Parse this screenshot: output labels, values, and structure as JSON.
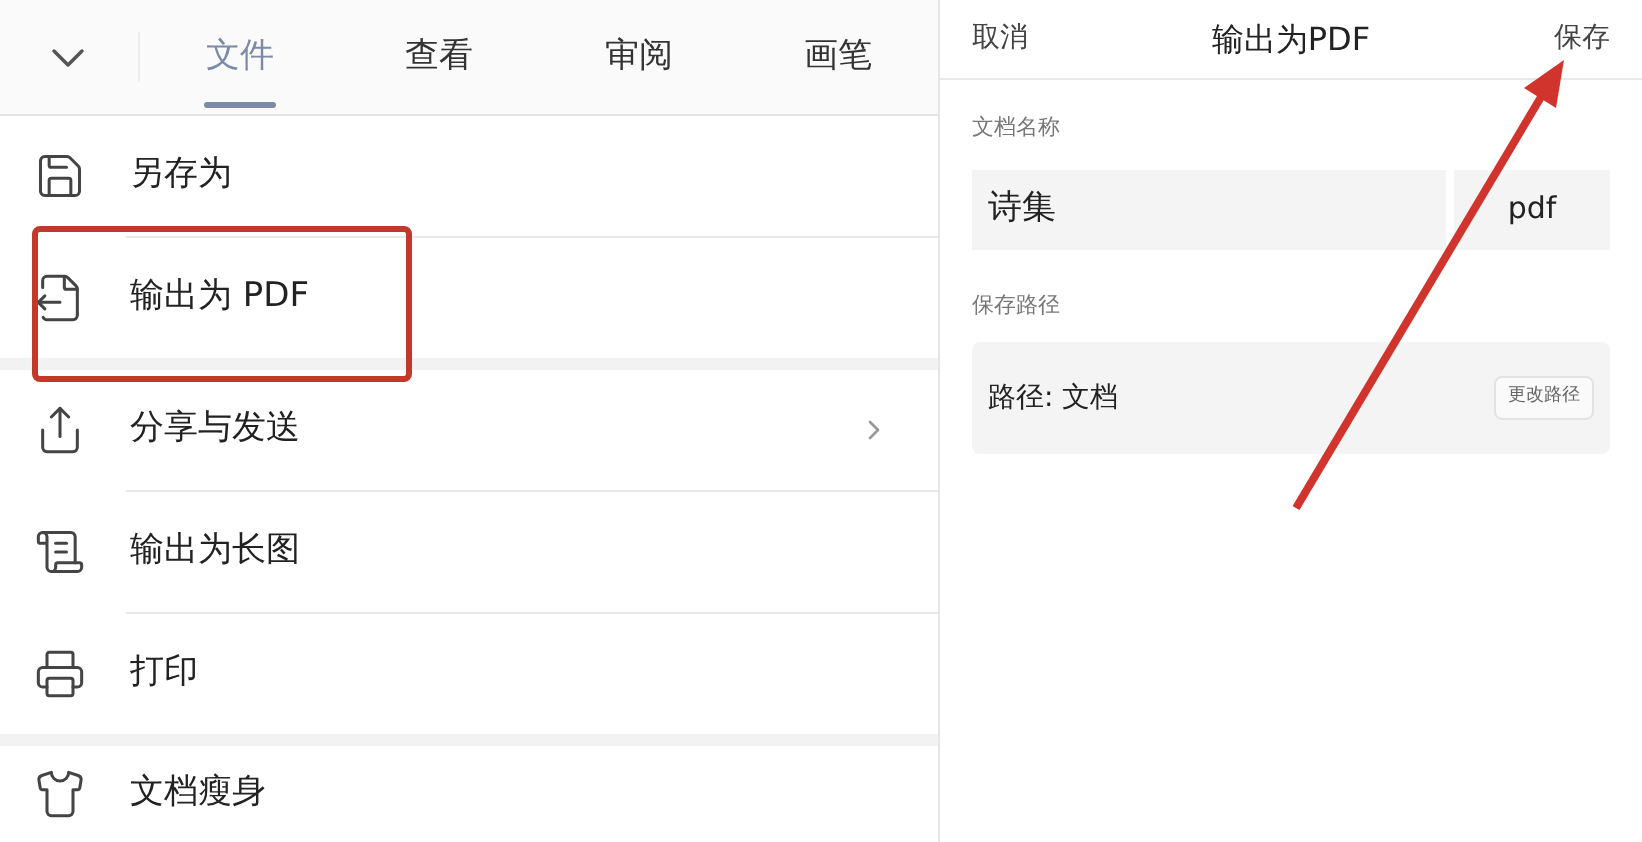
{
  "tabs": [
    {
      "label": "文件",
      "selected": true
    },
    {
      "label": "查看",
      "selected": false
    },
    {
      "label": "审阅",
      "selected": false
    },
    {
      "label": "画笔",
      "selected": false
    }
  ],
  "menu_groups": [
    [
      {
        "label": "另存为",
        "highlighted": false,
        "has_submenu": false
      },
      {
        "label": "输出为 PDF",
        "highlighted": true,
        "has_submenu": false
      }
    ],
    [
      {
        "label": "分享与发送",
        "highlighted": false,
        "has_submenu": true
      },
      {
        "label": "输出为长图",
        "highlighted": false,
        "has_submenu": false
      },
      {
        "label": "打印",
        "highlighted": false,
        "has_submenu": false
      }
    ],
    [
      {
        "label": "文档瘦身",
        "highlighted": false,
        "has_submenu": false
      }
    ]
  ],
  "dialog": {
    "cancel": "取消",
    "title": "输出为PDF",
    "save": "保存",
    "name_label": "文档名称",
    "name_value": "诗集",
    "extension": "pdf",
    "path_label": "保存路径",
    "path_value": "路径: 文档",
    "change_path": "更改路径"
  }
}
